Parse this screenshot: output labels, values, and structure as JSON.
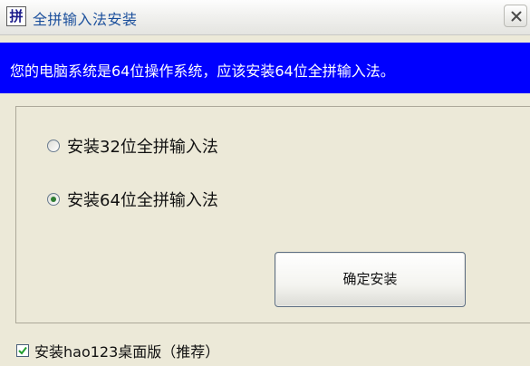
{
  "window": {
    "title": "全拼输入法安装",
    "icon_glyph": "拼",
    "icon": "app-icon",
    "close_icon": "close-icon"
  },
  "banner": {
    "message": "您的电脑系统是64位操作系统，应该安装64位全拼输入法。",
    "color": "#0000ff"
  },
  "options": [
    {
      "label": "安装32位全拼输入法",
      "selected": false
    },
    {
      "label": "安装64位全拼输入法",
      "selected": true
    }
  ],
  "install_button": {
    "label": "确定安装"
  },
  "extra": {
    "label": "安装hao123桌面版（推荐）",
    "checked": true
  }
}
